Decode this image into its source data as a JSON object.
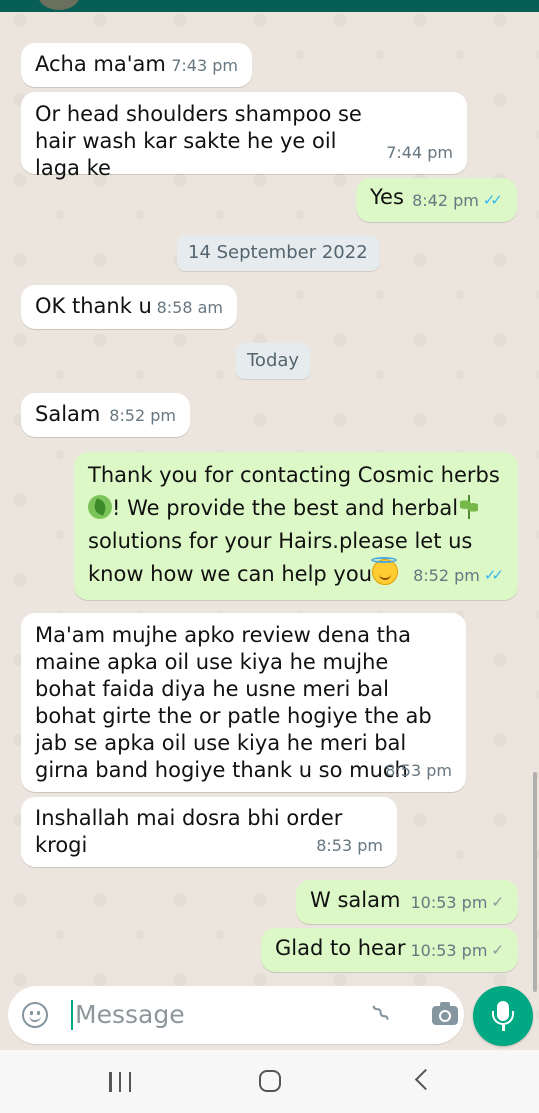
{
  "messages": [
    {
      "id": "m1",
      "dir": "in",
      "text": "Acha ma'am",
      "time": "7:43 pm"
    },
    {
      "id": "m2",
      "dir": "in",
      "text": "Or head shoulders shampoo se hair wash kar sakte he ye oil laga ke",
      "time": "7:44 pm"
    },
    {
      "id": "m3",
      "dir": "out",
      "text": "Yes",
      "time": "8:42 pm"
    },
    {
      "id": "d1",
      "type": "date",
      "text": "14 September 2022"
    },
    {
      "id": "m4",
      "dir": "in",
      "text": "OK thank u",
      "time": "8:58 am"
    },
    {
      "id": "d2",
      "type": "date",
      "text": "Today"
    },
    {
      "id": "m5",
      "dir": "in",
      "text": "Salam",
      "time": "8:52 pm"
    },
    {
      "id": "m6",
      "dir": "out",
      "text_parts": [
        "Thank you for contacting Cosmic herbs",
        "! We provide the best and herbal",
        "solutions for your Hairs.please let us know how we can help you"
      ],
      "time": "8:52 pm"
    },
    {
      "id": "m7",
      "dir": "in",
      "text": "Ma'am mujhe apko review dena tha maine apka oil use kiya he mujhe bohat faida diya he usne meri bal bohat girte the or patle hogiye the ab jab se apka oil use kiya he meri bal girna band hogiye thank u so much",
      "time": "8:53 pm"
    },
    {
      "id": "m8",
      "dir": "in",
      "text": "Inshallah mai dosra bhi order krogi",
      "time": "8:53 pm"
    },
    {
      "id": "m9",
      "dir": "out",
      "text": "W salam",
      "time": "10:53 pm"
    },
    {
      "id": "m10",
      "dir": "out",
      "text": "Glad to hear",
      "time": "10:53 pm"
    }
  ],
  "input": {
    "placeholder": "Message"
  },
  "icons": {
    "emoji": "emoji-icon",
    "attach": "paperclip-icon",
    "camera": "camera-icon",
    "mic": "microphone-icon",
    "read": "double-check-icon",
    "delivered": "double-check-icon"
  },
  "colors": {
    "incoming": "#ffffff",
    "outgoing": "#dcf8c6",
    "accent": "#00a884",
    "read_tick": "#34b7f1"
  }
}
